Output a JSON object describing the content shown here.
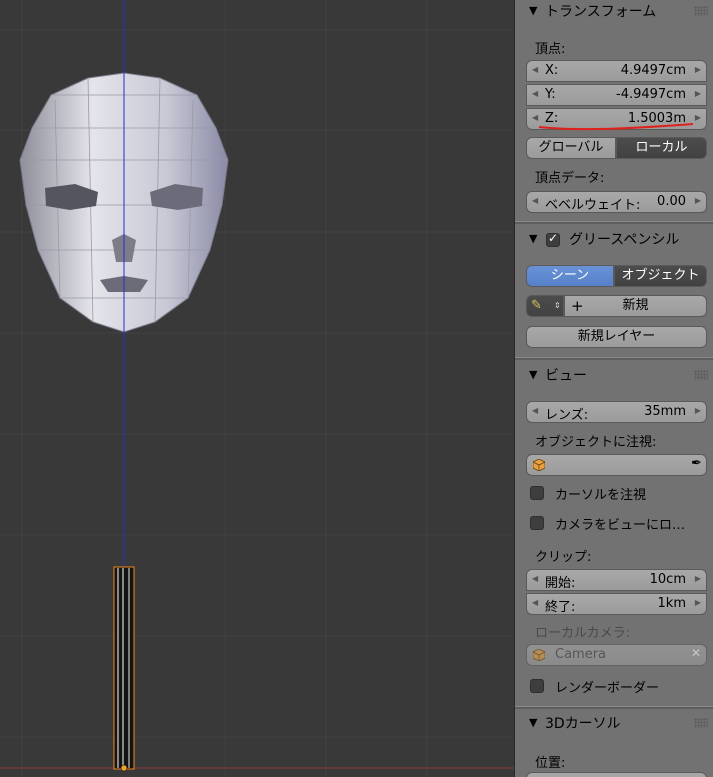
{
  "panel": {
    "transform": {
      "title": "トランスフォーム",
      "vertex_label": "頂点:",
      "x_label": "X:",
      "x_value": "4.9497cm",
      "y_label": "Y:",
      "y_value": "-4.9497cm",
      "z_label": "Z:",
      "z_value": "1.5003m",
      "global_label": "グローバル",
      "local_label": "ローカル",
      "vertex_data_label": "頂点データ:",
      "bevel_label": "ベベルウェイト:",
      "bevel_value": "0.00"
    },
    "grease_pencil": {
      "title": "グリースペンシル",
      "scene_label": "シーン",
      "object_label": "オブジェクト",
      "new_label": "新規",
      "new_layer_label": "新規レイヤー"
    },
    "view": {
      "title": "ビュー",
      "lens_label": "レンズ:",
      "lens_value": "35mm",
      "lock_object_label": "オブジェクトに注視:",
      "lock_cursor_label": "カーソルを注視",
      "camera_to_view_label": "カメラをビューにロ…",
      "clip_label": "クリップ:",
      "clip_start_label": "開始:",
      "clip_start_value": "10cm",
      "clip_end_label": "終了:",
      "clip_end_value": "1km",
      "local_camera_label": "ローカルカメラ:",
      "camera_value": "Camera",
      "render_border_label": "レンダーボーダー"
    },
    "cursor3d": {
      "title": "3Dカーソル",
      "location_label": "位置:"
    }
  },
  "colors": {
    "viewport_bg": "#393939",
    "panel_bg": "#727272",
    "accent_blue": "#5680c9",
    "annotation_red": "#e0201a",
    "axis_blue": "#2a2ad0"
  }
}
